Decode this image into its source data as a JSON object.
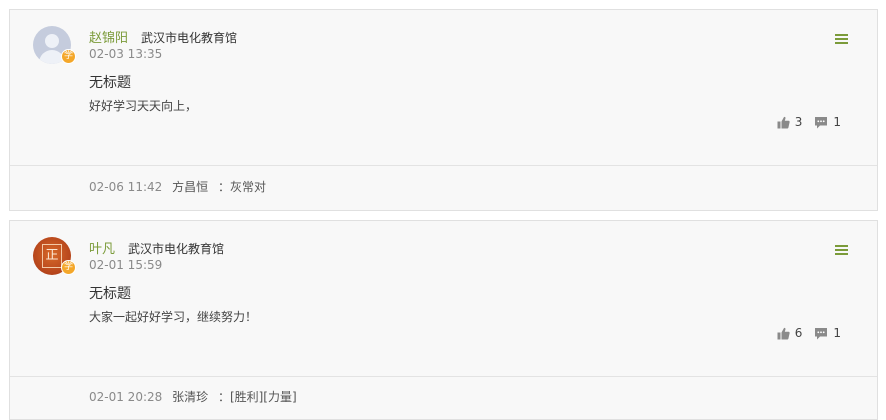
{
  "posts": [
    {
      "author": "赵锦阳",
      "org": "武汉市电化教育馆",
      "time": "02-03 13:35",
      "title": "无标题",
      "body": "好好学习天天向上，",
      "likes": "3",
      "comments": "1",
      "badge": "学",
      "avatar_icon": "default-user-avatar",
      "reply": {
        "time": "02-06 11:42",
        "user": "方昌恒",
        "text": "：灰常对"
      }
    },
    {
      "author": "叶凡",
      "org": "武汉市电化教育馆",
      "time": "02-01 15:59",
      "title": "无标题",
      "body": "大家一起好好学习，继续努力！",
      "likes": "6",
      "comments": "1",
      "badge": "学",
      "avatar_icon": "red-seal-avatar",
      "avatar_glyph": "正",
      "reply": {
        "time": "02-01 20:28",
        "user": "张清珍",
        "text": "：[胜利][力量]"
      }
    }
  ],
  "colors": {
    "accent_green": "#7b9b3a",
    "badge_orange": "#f4a72a",
    "icon_gray": "#8a8a8a"
  }
}
